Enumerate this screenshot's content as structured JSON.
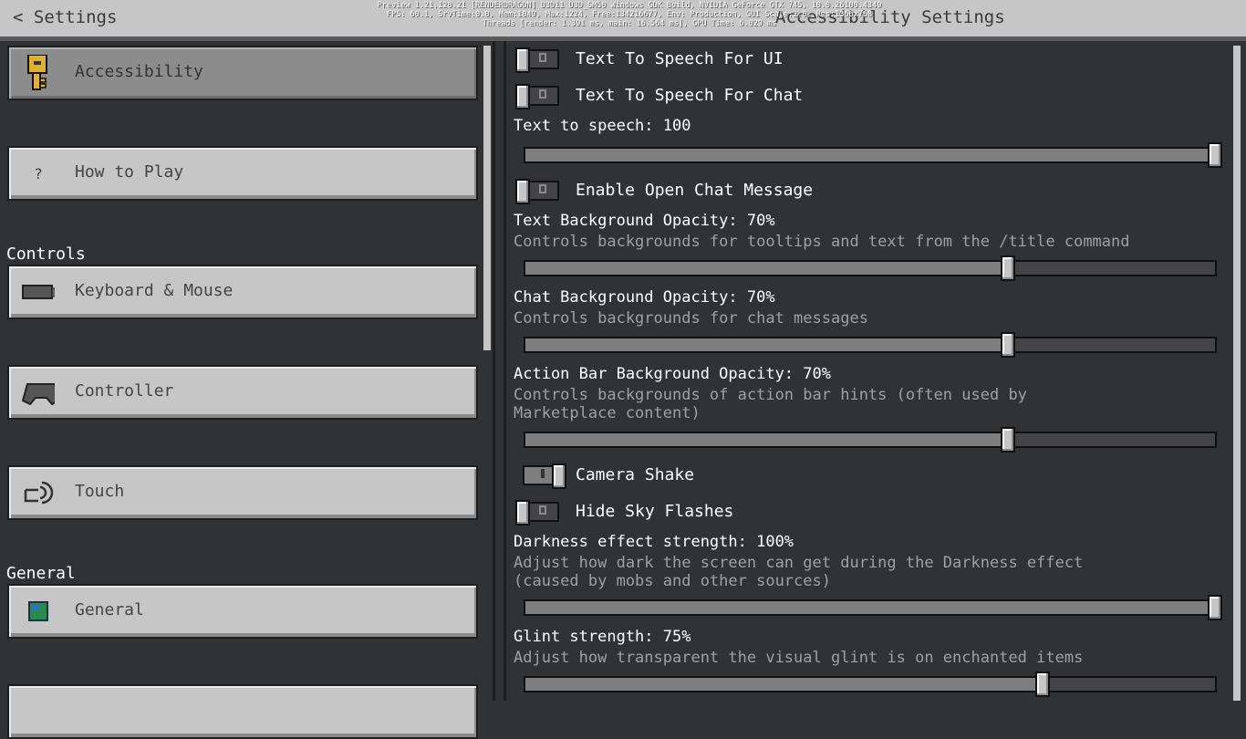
{
  "header": {
    "back_label": "< Settings",
    "title": "Accessibility Settings"
  },
  "debug": {
    "line1": "Preview 1.21.120.21 [RENDERDRAGON] D3D11 D3D_SM50 Windows GDK Build, NVIDIA GeForce GTX 745, 10.0.26100.4349",
    "line2": "FPS: 60.1, SrvTime:0.0, Mem:1049, Max:1224, Free:134216677, Env: Production, GUI Scale:2.0, Res:1366x768",
    "line3": "Threads [render: 1.391 ms, main: 16.564 ms], GPU Time: 6.029 ms"
  },
  "sidebar": {
    "items": [
      {
        "label": "Accessibility",
        "icon": "key-icon",
        "selected": true
      },
      {
        "label": "How to Play",
        "icon": "question-icon"
      },
      {
        "label": "Keyboard & Mouse",
        "icon": "keyboard-icon"
      },
      {
        "label": "Controller",
        "icon": "controller-icon"
      },
      {
        "label": "Touch",
        "icon": "touch-icon"
      },
      {
        "label": "General",
        "icon": "globe-icon"
      }
    ],
    "sections": {
      "controls": "Controls",
      "general": "General"
    }
  },
  "settings": {
    "tts_ui": {
      "label": "Text To Speech For UI",
      "on": false
    },
    "tts_chat": {
      "label": "Text To Speech For Chat",
      "on": false
    },
    "tts_volume": {
      "label": "Text to speech: 100",
      "value": 100
    },
    "open_chat": {
      "label": "Enable Open Chat Message",
      "on": false
    },
    "text_bg": {
      "label": "Text Background Opacity: 70%",
      "desc": "Controls backgrounds for tooltips and text from the /title command",
      "value": 70
    },
    "chat_bg": {
      "label": "Chat Background Opacity: 70%",
      "desc": "Controls backgrounds for chat messages",
      "value": 70
    },
    "actionbar_bg": {
      "label": "Action Bar Background Opacity: 70%",
      "desc": "Controls backgrounds of action bar hints (often used by Marketplace content)",
      "value": 70
    },
    "camera_shake": {
      "label": "Camera Shake",
      "on": true
    },
    "sky_flashes": {
      "label": "Hide Sky Flashes",
      "on": false
    },
    "darkness": {
      "label": "Darkness effect strength: 100%",
      "desc": "Adjust how dark the screen can get during the Darkness effect (caused by mobs and other sources)",
      "value": 100
    },
    "glint": {
      "label": "Glint strength: 75%",
      "desc": "Adjust how transparent the visual glint is on enchanted items",
      "value": 75
    }
  }
}
